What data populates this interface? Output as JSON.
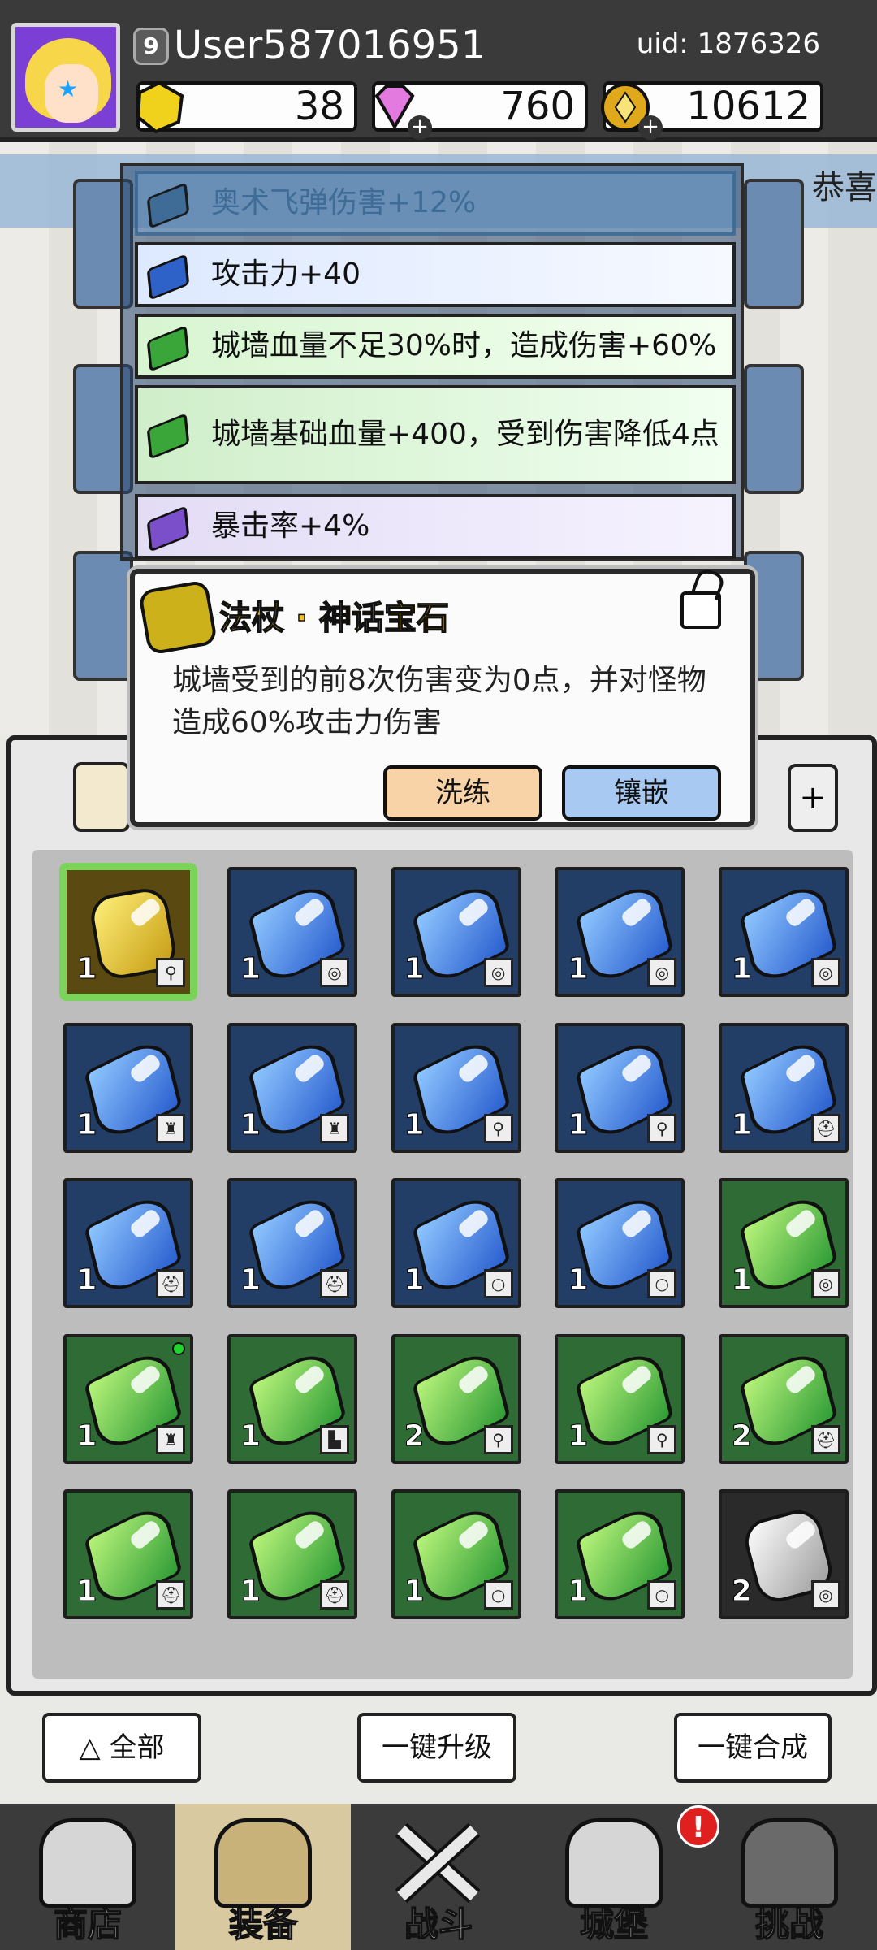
{
  "header": {
    "level": "9",
    "username": "User587016951",
    "uid": "uid: 1876326",
    "resources": {
      "gold_crystal": "38",
      "diamonds": "760",
      "coins": "10612"
    }
  },
  "banner_text": "恭喜",
  "stats": [
    {
      "text": "奥术飞弹伤害+12%",
      "gem_color": "#3c6b97"
    },
    {
      "text": "攻击力+40",
      "gem_color": "#2f62c8"
    },
    {
      "text": "城墙血量不足30%时，造成伤害+60%",
      "gem_color": "#3aa63a"
    },
    {
      "text": "城墙基础血量+400，受到伤害降低4点",
      "gem_color": "#3aa63a"
    },
    {
      "text": "暴击率+4%",
      "gem_color": "#7a4fc9"
    }
  ],
  "popup": {
    "title": "法杖 · 神话宝石",
    "description": "城墙受到的前8次伤害变为0点，并对怪物造成60%攻击力伤害",
    "reforge_label": "洗练",
    "inlay_label": "镶嵌"
  },
  "inventory": {
    "items": [
      {
        "tier": "gold",
        "count": "1",
        "slot": "staff",
        "selected": true
      },
      {
        "tier": "blue",
        "count": "1",
        "slot": "ring"
      },
      {
        "tier": "blue",
        "count": "1",
        "slot": "ring"
      },
      {
        "tier": "blue",
        "count": "1",
        "slot": "ring"
      },
      {
        "tier": "blue",
        "count": "1",
        "slot": "ring"
      },
      {
        "tier": "blue",
        "count": "1",
        "slot": "armor"
      },
      {
        "tier": "blue",
        "count": "1",
        "slot": "armor"
      },
      {
        "tier": "blue",
        "count": "1",
        "slot": "staff"
      },
      {
        "tier": "blue",
        "count": "1",
        "slot": "staff"
      },
      {
        "tier": "blue",
        "count": "1",
        "slot": "helmet"
      },
      {
        "tier": "blue",
        "count": "1",
        "slot": "helmet"
      },
      {
        "tier": "blue",
        "count": "1",
        "slot": "helmet"
      },
      {
        "tier": "blue",
        "count": "1",
        "slot": "necklace"
      },
      {
        "tier": "blue",
        "count": "1",
        "slot": "necklace"
      },
      {
        "tier": "green",
        "count": "1",
        "slot": "ring"
      },
      {
        "tier": "green",
        "count": "1",
        "slot": "armor",
        "new": true
      },
      {
        "tier": "green",
        "count": "1",
        "slot": "boots"
      },
      {
        "tier": "green",
        "count": "2",
        "slot": "staff"
      },
      {
        "tier": "green",
        "count": "1",
        "slot": "staff"
      },
      {
        "tier": "green",
        "count": "2",
        "slot": "helmet"
      },
      {
        "tier": "green",
        "count": "1",
        "slot": "helmet"
      },
      {
        "tier": "green",
        "count": "1",
        "slot": "helmet"
      },
      {
        "tier": "green",
        "count": "1",
        "slot": "necklace"
      },
      {
        "tier": "green",
        "count": "1",
        "slot": "necklace"
      },
      {
        "tier": "white",
        "count": "2",
        "slot": "ring"
      }
    ]
  },
  "bottom_buttons": {
    "all": "全部",
    "upgrade": "一键升级",
    "merge": "一键合成"
  },
  "tabs": [
    {
      "label": "商店"
    },
    {
      "label": "装备"
    },
    {
      "label": "战斗"
    },
    {
      "label": "城堡"
    },
    {
      "label": "挑战"
    }
  ],
  "alert_badge": "!"
}
